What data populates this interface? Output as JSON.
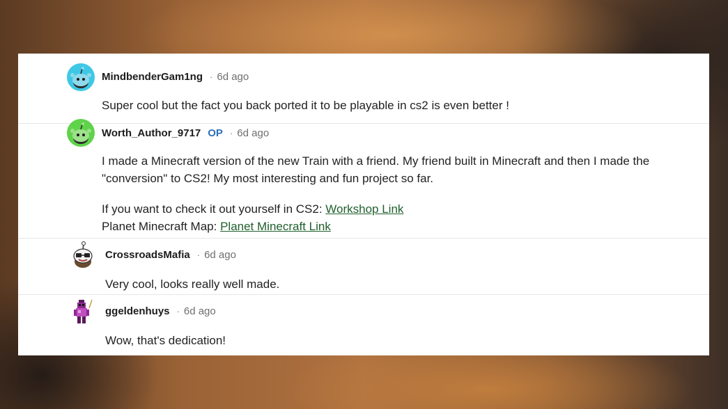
{
  "comments": [
    {
      "username": "MindbenderGam1ng",
      "op": "",
      "separator": "·",
      "time": "6d ago",
      "body": "Super cool but the fact you back ported it to be playable in cs2 is even better !"
    },
    {
      "username": "Worth_Author_9717",
      "op": "OP",
      "separator": "·",
      "time": "6d ago",
      "body_lines": [
        "I made a Minecraft version of the new Train with a friend. My friend built in Minecraft and then I made the",
        "\"conversion\" to CS2! My most interesting and fun project so far."
      ],
      "workshop_prefix": "If you want to check it out yourself in CS2: ",
      "workshop_link": "Workshop Link",
      "planet_prefix": "Planet Minecraft Map: ",
      "planet_link": "Planet Minecraft Link"
    },
    {
      "username": "CrossroadsMafia",
      "op": "",
      "separator": "·",
      "time": "6d ago",
      "body": "Very cool, looks really well made."
    },
    {
      "username": "ggeldenhuys",
      "op": "",
      "separator": "·",
      "time": "6d ago",
      "body": "Wow, that's dedication!"
    }
  ],
  "colors": {
    "avatar_cyan": "#3ec8e6",
    "avatar_green": "#5fd34a",
    "link_green": "#1f5f2c",
    "op_blue": "#2f6fb7"
  },
  "icons": [
    "snoo-avatar-icon",
    "snoo-avatar-icon",
    "snoo-glasses-avatar-icon",
    "pixel-avatar-icon"
  ]
}
